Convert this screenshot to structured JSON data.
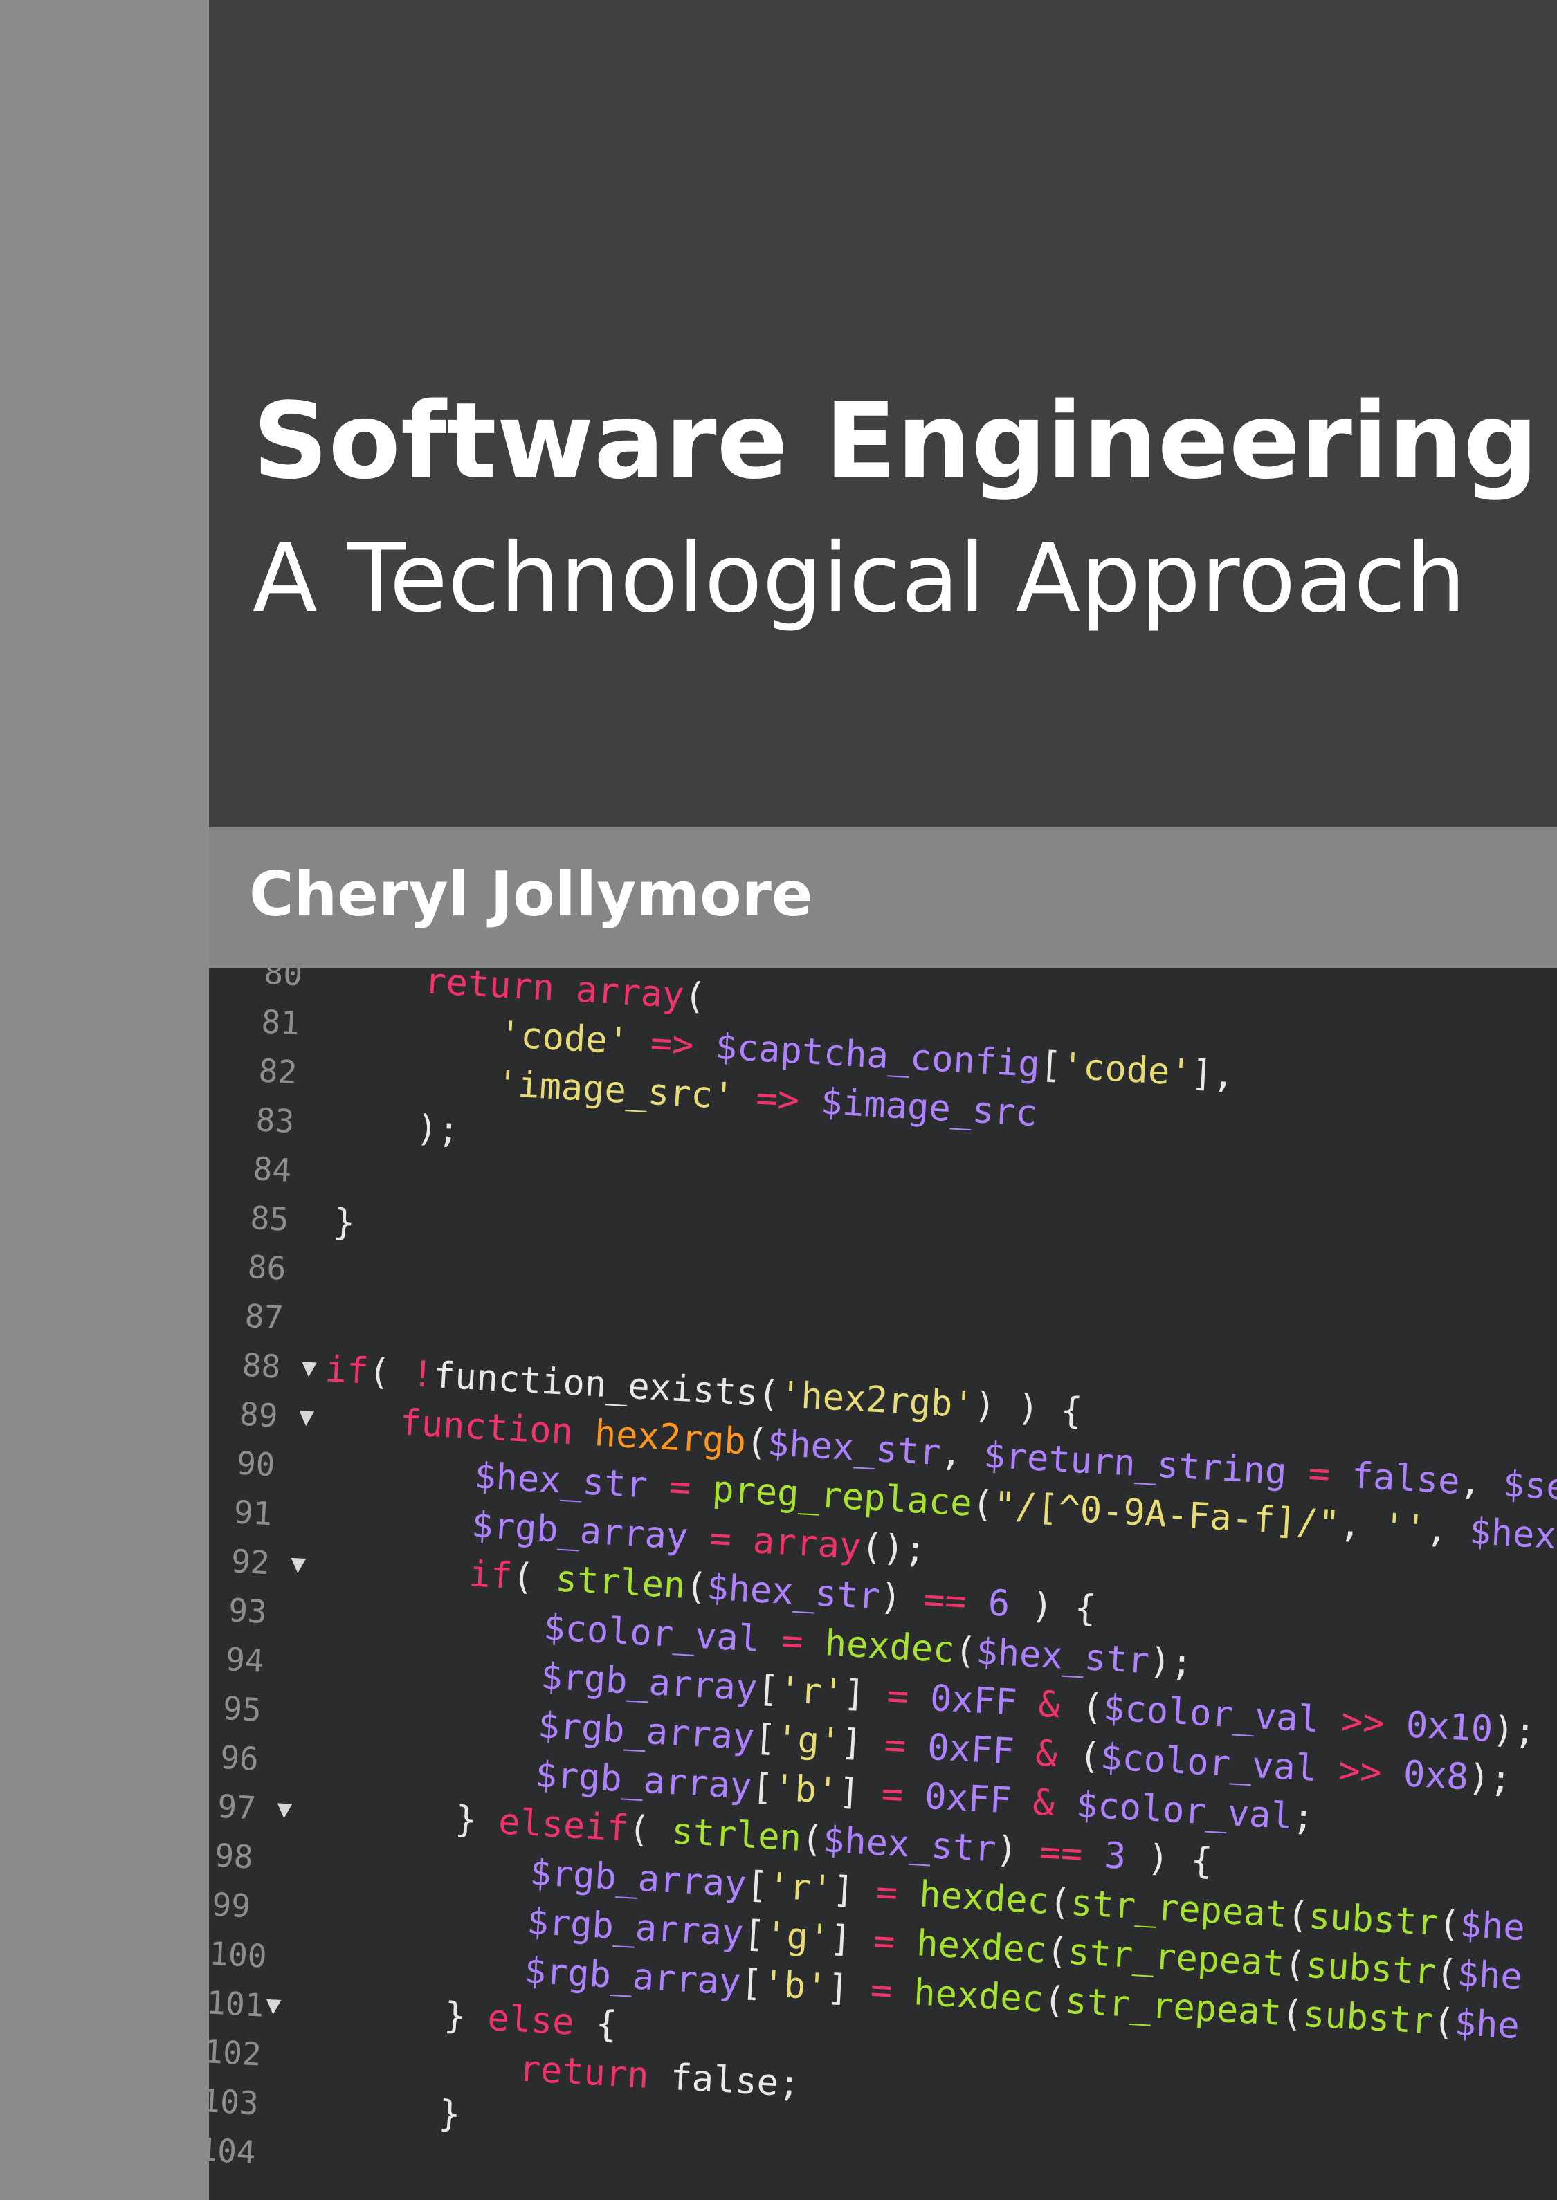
{
  "cover": {
    "title": "Software Engineering",
    "subtitle": "A Technological Approach",
    "author": "Cheryl Jollymore"
  },
  "colors": {
    "title_panel": "#3f4042",
    "author_band": "#858687",
    "spine": "#8a8b8c",
    "code_background": "#2b2c2e",
    "keyword": "#f0346a",
    "function": "#a6e22e",
    "string": "#e6db74",
    "variable": "#ae81ff",
    "plain": "#e8e8e8",
    "line_number": "#8d8e90"
  },
  "code": {
    "lines": [
      {
        "n": "80",
        "fold": false,
        "indent": 2,
        "tokens": [
          [
            "return",
            "keyword"
          ],
          [
            " ",
            "plain"
          ],
          [
            "array",
            "keyword"
          ],
          [
            "(",
            "plain"
          ]
        ]
      },
      {
        "n": "81",
        "fold": false,
        "indent": 3,
        "tokens": [
          [
            "'code'",
            "string"
          ],
          [
            " ",
            "plain"
          ],
          [
            "=>",
            "keyword"
          ],
          [
            " ",
            "plain"
          ],
          [
            "$captcha_config",
            "variable"
          ],
          [
            "[",
            "plain"
          ],
          [
            "'code'",
            "string"
          ],
          [
            "],",
            "plain"
          ]
        ]
      },
      {
        "n": "82",
        "fold": false,
        "indent": 3,
        "tokens": [
          [
            "'image_src'",
            "string"
          ],
          [
            " ",
            "plain"
          ],
          [
            "=>",
            "keyword"
          ],
          [
            " ",
            "plain"
          ],
          [
            "$image_src",
            "variable"
          ]
        ]
      },
      {
        "n": "83",
        "fold": false,
        "indent": 2,
        "tokens": [
          [
            ");",
            "plain"
          ]
        ]
      },
      {
        "n": "84",
        "fold": false,
        "indent": 0,
        "tokens": []
      },
      {
        "n": "85",
        "fold": false,
        "indent": 1,
        "tokens": [
          [
            "}",
            "plain"
          ]
        ]
      },
      {
        "n": "86",
        "fold": false,
        "indent": 0,
        "tokens": []
      },
      {
        "n": "87",
        "fold": false,
        "indent": 0,
        "tokens": []
      },
      {
        "n": "88",
        "fold": true,
        "indent": 1,
        "tokens": [
          [
            "if",
            "keyword"
          ],
          [
            "( ",
            "plain"
          ],
          [
            "!",
            "keyword"
          ],
          [
            "function_exists(",
            "plain"
          ],
          [
            "'hex2rgb'",
            "string"
          ],
          [
            ") ) {",
            "plain"
          ]
        ]
      },
      {
        "n": "89",
        "fold": true,
        "indent": 2,
        "tokens": [
          [
            "function",
            "keyword"
          ],
          [
            " ",
            "plain"
          ],
          [
            "hex2rgb",
            "function_name"
          ],
          [
            "(",
            "plain"
          ],
          [
            "$hex_str",
            "variable"
          ],
          [
            ", ",
            "plain"
          ],
          [
            "$return_string",
            "variable"
          ],
          [
            " ",
            "plain"
          ],
          [
            "=",
            "keyword"
          ],
          [
            " ",
            "plain"
          ],
          [
            "false",
            "variable"
          ],
          [
            ", ",
            "plain"
          ],
          [
            "$se",
            "variable"
          ]
        ]
      },
      {
        "n": "90",
        "fold": false,
        "indent": 3,
        "tokens": [
          [
            "$hex_str",
            "variable"
          ],
          [
            " ",
            "plain"
          ],
          [
            "=",
            "keyword"
          ],
          [
            " ",
            "plain"
          ],
          [
            "preg_replace",
            "function"
          ],
          [
            "(",
            "plain"
          ],
          [
            "\"/[^0-9A-Fa-f]/\"",
            "string"
          ],
          [
            ", ",
            "plain"
          ],
          [
            "''",
            "string"
          ],
          [
            ", ",
            "plain"
          ],
          [
            "$hex",
            "variable"
          ]
        ]
      },
      {
        "n": "91",
        "fold": false,
        "indent": 3,
        "tokens": [
          [
            "$rgb_array",
            "variable"
          ],
          [
            " ",
            "plain"
          ],
          [
            "=",
            "keyword"
          ],
          [
            " ",
            "plain"
          ],
          [
            "array",
            "keyword"
          ],
          [
            "();",
            "plain"
          ]
        ]
      },
      {
        "n": "92",
        "fold": true,
        "indent": 3,
        "tokens": [
          [
            "if",
            "keyword"
          ],
          [
            "( ",
            "plain"
          ],
          [
            "strlen",
            "function"
          ],
          [
            "(",
            "plain"
          ],
          [
            "$hex_str",
            "variable"
          ],
          [
            ") ",
            "plain"
          ],
          [
            "==",
            "keyword"
          ],
          [
            " ",
            "plain"
          ],
          [
            "6",
            "variable"
          ],
          [
            " ) {",
            "plain"
          ]
        ]
      },
      {
        "n": "93",
        "fold": false,
        "indent": 4,
        "tokens": [
          [
            "$color_val",
            "variable"
          ],
          [
            " ",
            "plain"
          ],
          [
            "=",
            "keyword"
          ],
          [
            " ",
            "plain"
          ],
          [
            "hexdec",
            "function"
          ],
          [
            "(",
            "plain"
          ],
          [
            "$hex_str",
            "variable"
          ],
          [
            ");",
            "plain"
          ]
        ]
      },
      {
        "n": "94",
        "fold": false,
        "indent": 4,
        "tokens": [
          [
            "$rgb_array",
            "variable"
          ],
          [
            "[",
            "plain"
          ],
          [
            "'r'",
            "string"
          ],
          [
            "] ",
            "plain"
          ],
          [
            "=",
            "keyword"
          ],
          [
            " ",
            "plain"
          ],
          [
            "0xFF",
            "variable"
          ],
          [
            " ",
            "plain"
          ],
          [
            "&",
            "keyword"
          ],
          [
            " (",
            "plain"
          ],
          [
            "$color_val",
            "variable"
          ],
          [
            " ",
            "plain"
          ],
          [
            ">>",
            "keyword"
          ],
          [
            " ",
            "plain"
          ],
          [
            "0x10",
            "variable"
          ],
          [
            ");",
            "plain"
          ]
        ]
      },
      {
        "n": "95",
        "fold": false,
        "indent": 4,
        "tokens": [
          [
            "$rgb_array",
            "variable"
          ],
          [
            "[",
            "plain"
          ],
          [
            "'g'",
            "string"
          ],
          [
            "] ",
            "plain"
          ],
          [
            "=",
            "keyword"
          ],
          [
            " ",
            "plain"
          ],
          [
            "0xFF",
            "variable"
          ],
          [
            " ",
            "plain"
          ],
          [
            "&",
            "keyword"
          ],
          [
            " (",
            "plain"
          ],
          [
            "$color_val",
            "variable"
          ],
          [
            " ",
            "plain"
          ],
          [
            ">>",
            "keyword"
          ],
          [
            " ",
            "plain"
          ],
          [
            "0x8",
            "variable"
          ],
          [
            ");",
            "plain"
          ]
        ]
      },
      {
        "n": "96",
        "fold": false,
        "indent": 4,
        "tokens": [
          [
            "$rgb_array",
            "variable"
          ],
          [
            "[",
            "plain"
          ],
          [
            "'b'",
            "string"
          ],
          [
            "] ",
            "plain"
          ],
          [
            "=",
            "keyword"
          ],
          [
            " ",
            "plain"
          ],
          [
            "0xFF",
            "variable"
          ],
          [
            " ",
            "plain"
          ],
          [
            "&",
            "keyword"
          ],
          [
            " ",
            "plain"
          ],
          [
            "$color_val",
            "variable"
          ],
          [
            ";",
            "plain"
          ]
        ]
      },
      {
        "n": "97",
        "fold": true,
        "indent": 3,
        "tokens": [
          [
            "} ",
            "plain"
          ],
          [
            "elseif",
            "keyword"
          ],
          [
            "( ",
            "plain"
          ],
          [
            "strlen",
            "function"
          ],
          [
            "(",
            "plain"
          ],
          [
            "$hex_str",
            "variable"
          ],
          [
            ") ",
            "plain"
          ],
          [
            "==",
            "keyword"
          ],
          [
            " ",
            "plain"
          ],
          [
            "3",
            "variable"
          ],
          [
            " ) {",
            "plain"
          ]
        ]
      },
      {
        "n": "98",
        "fold": false,
        "indent": 4,
        "tokens": [
          [
            "$rgb_array",
            "variable"
          ],
          [
            "[",
            "plain"
          ],
          [
            "'r'",
            "string"
          ],
          [
            "] ",
            "plain"
          ],
          [
            "=",
            "keyword"
          ],
          [
            " ",
            "plain"
          ],
          [
            "hexdec",
            "function"
          ],
          [
            "(",
            "plain"
          ],
          [
            "str_repeat",
            "function"
          ],
          [
            "(",
            "plain"
          ],
          [
            "substr",
            "function"
          ],
          [
            "(",
            "plain"
          ],
          [
            "$he",
            "variable"
          ]
        ]
      },
      {
        "n": "99",
        "fold": false,
        "indent": 4,
        "tokens": [
          [
            "$rgb_array",
            "variable"
          ],
          [
            "[",
            "plain"
          ],
          [
            "'g'",
            "string"
          ],
          [
            "] ",
            "plain"
          ],
          [
            "=",
            "keyword"
          ],
          [
            " ",
            "plain"
          ],
          [
            "hexdec",
            "function"
          ],
          [
            "(",
            "plain"
          ],
          [
            "str_repeat",
            "function"
          ],
          [
            "(",
            "plain"
          ],
          [
            "substr",
            "function"
          ],
          [
            "(",
            "plain"
          ],
          [
            "$he",
            "variable"
          ]
        ]
      },
      {
        "n": "100",
        "fold": false,
        "indent": 4,
        "tokens": [
          [
            "$rgb_array",
            "variable"
          ],
          [
            "[",
            "plain"
          ],
          [
            "'b'",
            "string"
          ],
          [
            "] ",
            "plain"
          ],
          [
            "=",
            "keyword"
          ],
          [
            " ",
            "plain"
          ],
          [
            "hexdec",
            "function"
          ],
          [
            "(",
            "plain"
          ],
          [
            "str_repeat",
            "function"
          ],
          [
            "(",
            "plain"
          ],
          [
            "substr",
            "function"
          ],
          [
            "(",
            "plain"
          ],
          [
            "$he",
            "variable"
          ]
        ]
      },
      {
        "n": "101",
        "fold": true,
        "indent": 3,
        "tokens": [
          [
            "} ",
            "plain"
          ],
          [
            "else",
            "keyword"
          ],
          [
            " {",
            "plain"
          ]
        ]
      },
      {
        "n": "102",
        "fold": false,
        "indent": 4,
        "tokens": [
          [
            "return",
            "keyword"
          ],
          [
            " false;",
            "plain"
          ]
        ]
      },
      {
        "n": "103",
        "fold": false,
        "indent": 3,
        "tokens": [
          [
            "}",
            "plain"
          ]
        ]
      },
      {
        "n": "104",
        "fold": false,
        "indent": 0,
        "tokens": []
      }
    ]
  }
}
